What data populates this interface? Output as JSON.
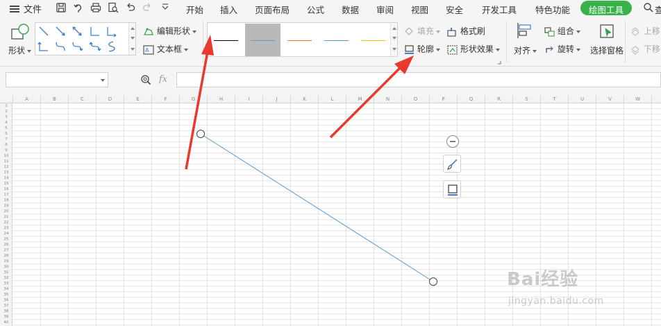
{
  "menu": {
    "file_label": "文件",
    "tabs": [
      "开始",
      "插入",
      "页面布局",
      "公式",
      "数据",
      "审阅",
      "视图",
      "安全",
      "开发工具",
      "特色功能",
      "绘图工具"
    ],
    "active_tab": "绘图工具",
    "trailing_label": "查"
  },
  "ribbon": {
    "shape_label": "形状",
    "edit_shape_label": "编辑形状",
    "text_box_label": "文本框",
    "fill_label": "填充",
    "format_painter_label": "格式刷",
    "outline_label": "轮廓",
    "shape_effects_label": "形状效果",
    "align_label": "对齐",
    "group_label": "组合",
    "rotate_label": "旋转",
    "selection_pane_label": "选择窗格",
    "move_up_label": "上移",
    "move_down_label": "下移",
    "style_swatches": [
      {
        "color": "#000000",
        "selected": false
      },
      {
        "color": "#5b9bd5",
        "selected": true
      },
      {
        "color": "#ed7d31",
        "selected": false
      },
      {
        "color": "#5b9bd5",
        "selected": false
      },
      {
        "color": "#ffc000",
        "selected": false
      }
    ]
  },
  "formula_bar": {
    "name_box_value": "",
    "fx_label": "fx",
    "formula_value": ""
  },
  "sheet": {
    "columns": [
      "A",
      "B",
      "C",
      "D",
      "E",
      "F",
      "G",
      "H",
      "I",
      "J",
      "K",
      "L",
      "M",
      "N",
      "O",
      "P",
      "Q",
      "R",
      "S",
      "T",
      "U",
      "V",
      "W"
    ],
    "rows": [
      "1",
      "2",
      "3",
      "4",
      "5",
      "6",
      "7",
      "8",
      "9",
      "10",
      "11",
      "12",
      "13",
      "14",
      "15",
      "16",
      "17",
      "18",
      "19",
      "20",
      "21",
      "22",
      "23",
      "24",
      "25",
      "26",
      "27",
      "28",
      "29",
      "30",
      "31",
      "32",
      "33",
      "34",
      "35",
      "36",
      "37",
      "38",
      "39",
      "40"
    ]
  },
  "drawing": {
    "line_color": "#5b9bd5",
    "arrow_color": "#e8392f"
  },
  "watermark": {
    "brand": "Bai经验",
    "url": "jingyan.baidu.com"
  },
  "colors": {
    "accent_green": "#38b34a",
    "ribbon_bg": "#f5f5f5"
  }
}
